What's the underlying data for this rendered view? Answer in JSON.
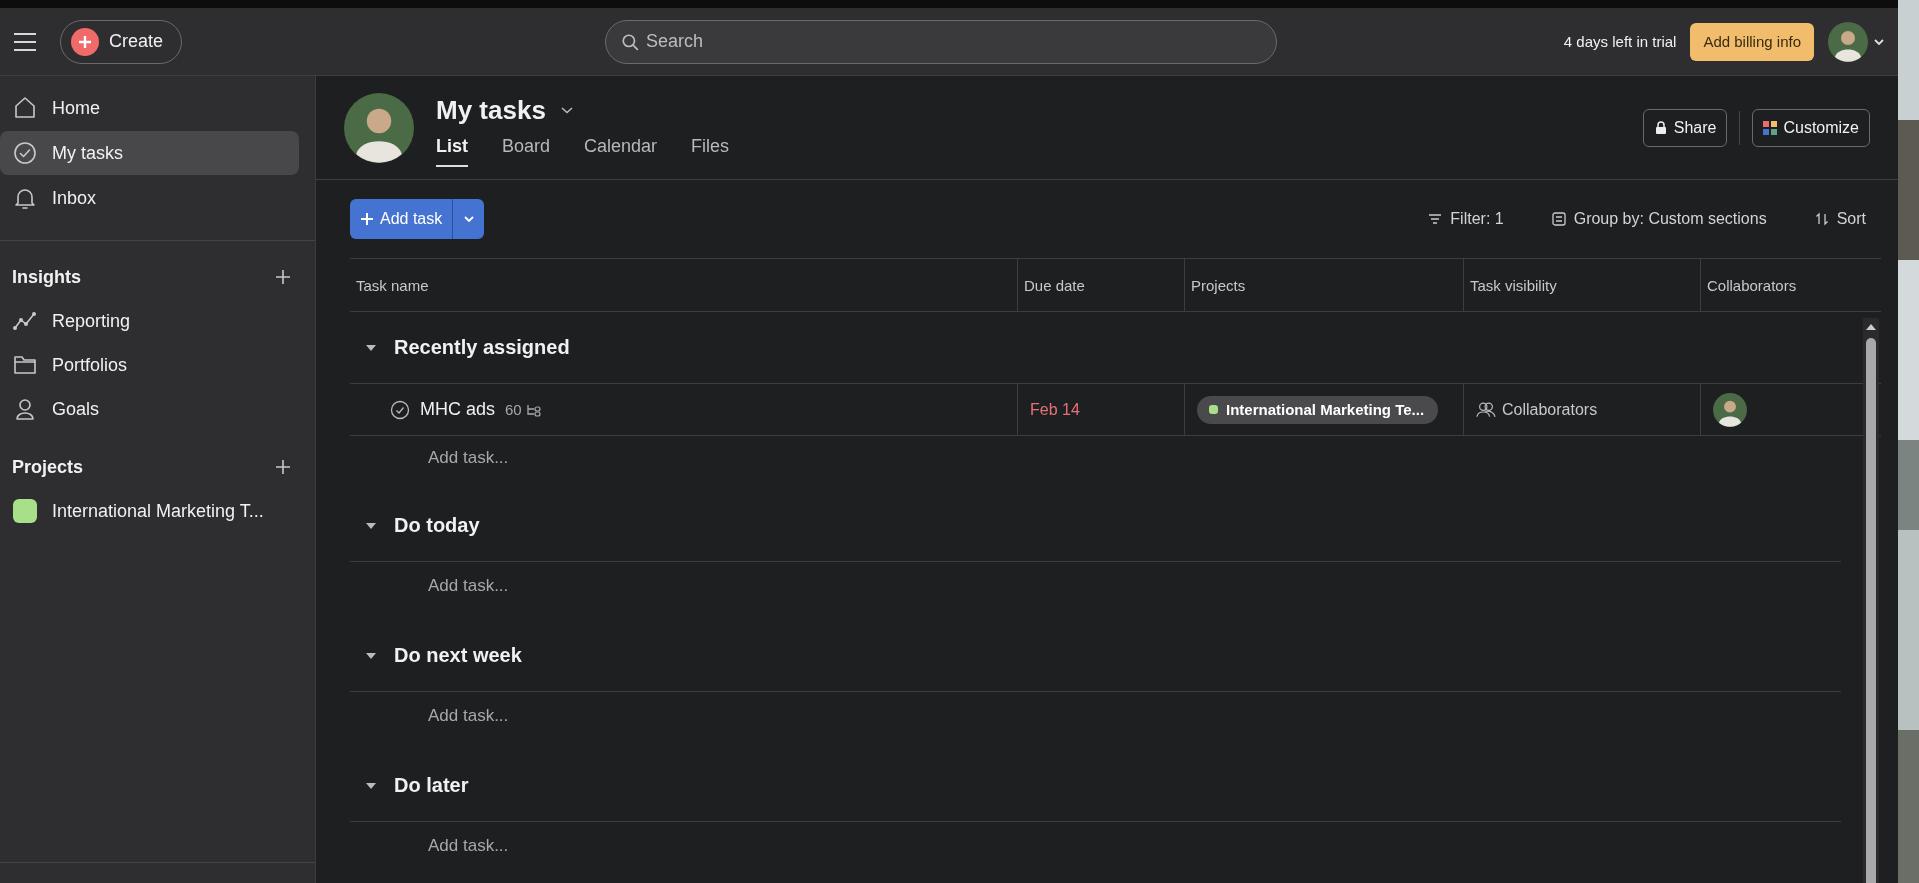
{
  "topbar": {
    "create": "Create",
    "search": {
      "placeholder": "Search"
    },
    "trial": "4 days left in trial",
    "billing": "Add billing info"
  },
  "sidebar": {
    "nav": [
      {
        "label": "Home",
        "selected": false
      },
      {
        "label": "My tasks",
        "selected": true
      },
      {
        "label": "Inbox",
        "selected": false
      }
    ],
    "groups": [
      {
        "title": "Insights",
        "items": [
          {
            "label": "Reporting"
          },
          {
            "label": "Portfolios"
          },
          {
            "label": "Goals"
          }
        ]
      },
      {
        "title": "Projects",
        "items": [
          {
            "label": "International Marketing T...",
            "color": "#a8e08a"
          }
        ]
      }
    ]
  },
  "header": {
    "title": "My tasks",
    "tabs": [
      {
        "label": "List",
        "selected": true
      },
      {
        "label": "Board",
        "selected": false
      },
      {
        "label": "Calendar",
        "selected": false
      },
      {
        "label": "Files",
        "selected": false
      }
    ],
    "share": "Share",
    "customize": "Customize"
  },
  "toolbar": {
    "add_task": "Add task",
    "filter": "Filter: 1",
    "group_by": "Group by: Custom sections",
    "sort": "Sort"
  },
  "table": {
    "columns": [
      "Task name",
      "Due date",
      "Projects",
      "Task visibility",
      "Collaborators"
    ],
    "sections": [
      {
        "title": "Recently assigned",
        "expanded": true,
        "tasks": [
          {
            "name": "MHC ads",
            "subtasks": "60",
            "due": "Feb 14",
            "overdue": true,
            "project": {
              "label": "International Marketing Te...",
              "color": "#a8e08a"
            },
            "visibility": "Collaborators",
            "collaborator": true
          }
        ],
        "add_task": "Add task..."
      },
      {
        "title": "Do today",
        "expanded": true,
        "add_task": "Add task..."
      },
      {
        "title": "Do next week",
        "expanded": true,
        "add_task": "Add task..."
      },
      {
        "title": "Do later",
        "expanded": true,
        "add_task": "Add task..."
      }
    ]
  }
}
